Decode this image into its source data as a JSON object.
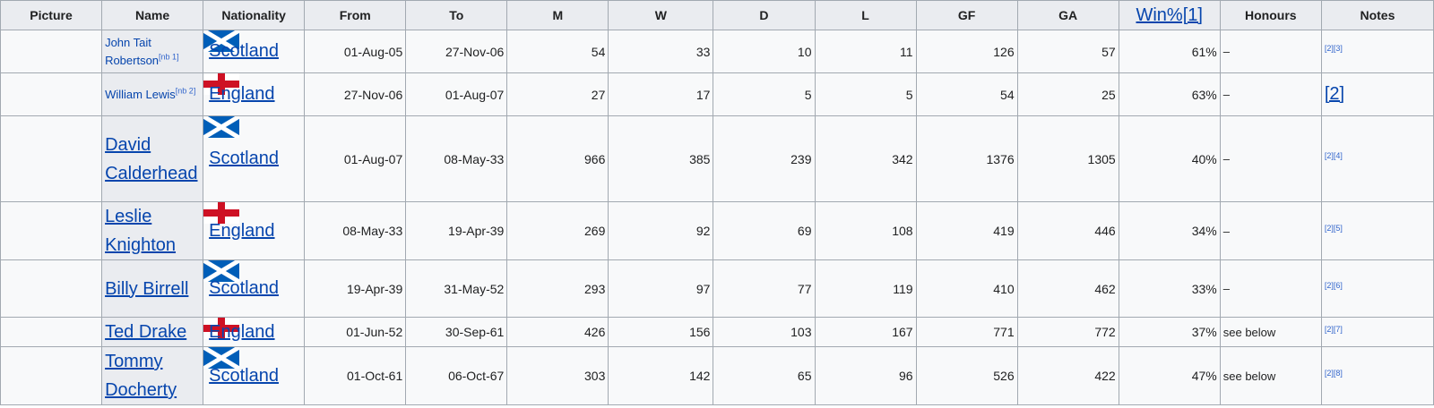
{
  "headers": {
    "picture": "Picture",
    "name": "Name",
    "nationality": "Nationality",
    "from": "From",
    "to": "To",
    "m": "M",
    "w": "W",
    "d": "D",
    "l": "L",
    "gf": "GF",
    "ga": "GA",
    "win": "Win%[1]",
    "honours": "Honours",
    "notes": "Notes"
  },
  "flags": {
    "scotland": "#005EB8",
    "england_cross": "#CE1124"
  },
  "rows": [
    {
      "name": "John Tait Robertson",
      "sup": "[nb 1]",
      "nat": "Scotland",
      "from": "01-Aug-05",
      "to": "27-Nov-06",
      "m": "54",
      "w": "33",
      "d": "10",
      "l": "11",
      "gf": "126",
      "ga": "57",
      "win": "61%",
      "honours": "–",
      "notes": "[2][3]"
    },
    {
      "name": "William Lewis",
      "sup": "[nb 2]",
      "nat": "England",
      "from": "27-Nov-06",
      "to": "01-Aug-07",
      "m": "27",
      "w": "17",
      "d": "5",
      "l": "5",
      "gf": "54",
      "ga": "25",
      "win": "63%",
      "honours": "–",
      "notes": "[2]"
    },
    {
      "name": "David Calderhead",
      "sup": "",
      "nat": "Scotland",
      "from": "01-Aug-07",
      "to": "08-May-33",
      "m": "966",
      "w": "385",
      "d": "239",
      "l": "342",
      "gf": "1376",
      "ga": "1305",
      "win": "40%",
      "honours": "–",
      "notes": "[2][4]"
    },
    {
      "name": "Leslie Knighton",
      "sup": "",
      "nat": "England",
      "from": "08-May-33",
      "to": "19-Apr-39",
      "m": "269",
      "w": "92",
      "d": "69",
      "l": "108",
      "gf": "419",
      "ga": "446",
      "win": "34%",
      "honours": "–",
      "notes": "[2][5]"
    },
    {
      "name": "Billy Birrell",
      "sup": "",
      "nat": "Scotland",
      "from": "19-Apr-39",
      "to": "31-May-52",
      "m": "293",
      "w": "97",
      "d": "77",
      "l": "119",
      "gf": "410",
      "ga": "462",
      "win": "33%",
      "honours": "–",
      "notes": "[2][6]"
    },
    {
      "name": "Ted Drake",
      "sup": "",
      "nat": "England",
      "from": "01-Jun-52",
      "to": "30-Sep-61",
      "m": "426",
      "w": "156",
      "d": "103",
      "l": "167",
      "gf": "771",
      "ga": "772",
      "win": "37%",
      "honours": "see below",
      "notes": "[2][7]"
    },
    {
      "name": "Tommy Docherty",
      "sup": "",
      "nat": "Scotland",
      "from": "01-Oct-61",
      "to": "06-Oct-67",
      "m": "303",
      "w": "142",
      "d": "65",
      "l": "96",
      "gf": "526",
      "ga": "422",
      "win": "47%",
      "honours": "see below",
      "notes": "[2][8]"
    }
  ]
}
